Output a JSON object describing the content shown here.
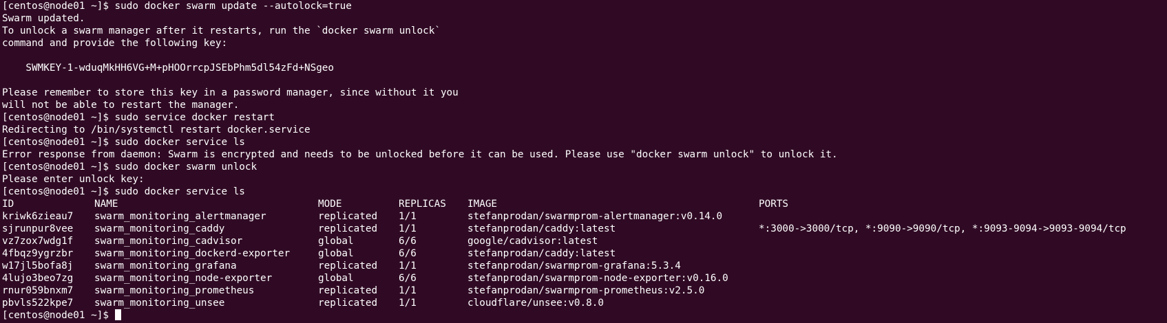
{
  "terminal": {
    "background": "#300a24",
    "foreground": "#ffffff",
    "prompt": "[centos@node01 ~]$ ",
    "lines_before_table": [
      "[centos@node01 ~]$ sudo docker swarm update --autolock=true",
      "Swarm updated.",
      "To unlock a swarm manager after it restarts, run the `docker swarm unlock`",
      "command and provide the following key:",
      "",
      "    SWMKEY-1-wduqMkHH6VG+M+pHOOrrcpJSEbPhm5dl54zFd+NSgeo",
      "",
      "Please remember to store this key in a password manager, since without it you",
      "will not be able to restart the manager.",
      "[centos@node01 ~]$ sudo service docker restart",
      "Redirecting to /bin/systemctl restart docker.service",
      "[centos@node01 ~]$ sudo docker service ls",
      "Error response from daemon: Swarm is encrypted and needs to be unlocked before it can be used. Please use \"docker swarm unlock\" to unlock it.",
      "[centos@node01 ~]$ sudo docker swarm unlock",
      "Please enter unlock key:",
      "[centos@node01 ~]$ sudo docker service ls"
    ],
    "table": {
      "headers": [
        "ID",
        "NAME",
        "MODE",
        "REPLICAS",
        "IMAGE",
        "PORTS"
      ],
      "rows": [
        [
          "kriwk6zieau7",
          "swarm_monitoring_alertmanager",
          "replicated",
          "1/1",
          "stefanprodan/swarmprom-alertmanager:v0.14.0",
          ""
        ],
        [
          "sjrunpur8vee",
          "swarm_monitoring_caddy",
          "replicated",
          "1/1",
          "stefanprodan/caddy:latest",
          "*:3000->3000/tcp, *:9090->9090/tcp, *:9093-9094->9093-9094/tcp"
        ],
        [
          "vz7zox7wdg1f",
          "swarm_monitoring_cadvisor",
          "global",
          "6/6",
          "google/cadvisor:latest",
          ""
        ],
        [
          "4fbqz9ygrzbr",
          "swarm_monitoring_dockerd-exporter",
          "global",
          "6/6",
          "stefanprodan/caddy:latest",
          ""
        ],
        [
          "w17jl5bofa8j",
          "swarm_monitoring_grafana",
          "replicated",
          "1/1",
          "stefanprodan/swarmprom-grafana:5.3.4",
          ""
        ],
        [
          "4lujo3beo7zg",
          "swarm_monitoring_node-exporter",
          "global",
          "6/6",
          "stefanprodan/swarmprom-node-exporter:v0.16.0",
          ""
        ],
        [
          "rnur059bnxm7",
          "swarm_monitoring_prometheus",
          "replicated",
          "1/1",
          "stefanprodan/swarmprom-prometheus:v2.5.0",
          ""
        ],
        [
          "pbvls522kpe7",
          "swarm_monitoring_unsee",
          "replicated",
          "1/1",
          "cloudflare/unsee:v0.8.0",
          ""
        ]
      ]
    },
    "final_prompt": "[centos@node01 ~]$ "
  }
}
